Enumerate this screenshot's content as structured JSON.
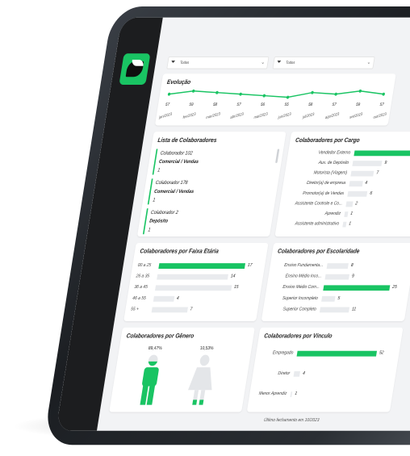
{
  "filters": [
    {
      "label": "Todos"
    },
    {
      "label": "Todos"
    }
  ],
  "evolucao": {
    "title": "Evolução",
    "points": [
      57,
      59,
      58,
      57,
      56,
      55,
      58,
      57,
      59,
      57
    ],
    "months": [
      "jan/2023",
      "fev/2023",
      "mar/2023",
      "abr/2023",
      "mai/2023",
      "jun/2023",
      "jul/2023",
      "ago/2023",
      "set/2023",
      "out/2023"
    ]
  },
  "lista": {
    "title": "Lista de Colaboradores",
    "items": [
      {
        "name": "Colaborador 102",
        "dept": "Comercial / Vendas",
        "count": "1"
      },
      {
        "name": "Colaborador 178",
        "dept": "Comercial / Vendas",
        "count": "1"
      },
      {
        "name": "Colaborador 2",
        "dept": "Depósito",
        "count": "1"
      }
    ]
  },
  "cargo": {
    "title": "Colaboradores por Cargo",
    "rows": [
      {
        "label": "Vendedor Externo",
        "value": 18
      },
      {
        "label": "Aux. de Depósito",
        "value": 9
      },
      {
        "label": "Motorista (Viagem)",
        "value": 7
      },
      {
        "label": "Diretor(a) de empresa",
        "value": 4
      },
      {
        "label": "Promotor(a) de Vendas",
        "value": 6
      },
      {
        "label": "Assistente Controle e Co...",
        "value": 2
      },
      {
        "label": "Aprendiz",
        "value": 1
      },
      {
        "label": "Assistente administrativo",
        "value": 1
      }
    ]
  },
  "faixa": {
    "title": "Colaboradores por Faixa Etária",
    "rows": [
      {
        "label": "00 a 25",
        "value": 17
      },
      {
        "label": "26 a 35",
        "value": 14
      },
      {
        "label": "36 a 45",
        "value": 15
      },
      {
        "label": "46 a 55",
        "value": 4
      },
      {
        "label": "55 +",
        "value": 7
      }
    ]
  },
  "escolaridade": {
    "title": "Colaboradores por Escolaridade",
    "rows": [
      {
        "label": "Ensino Fundamenta...",
        "value": 8
      },
      {
        "label": "Ensino Médio Inco...",
        "value": 9
      },
      {
        "label": "Ensino Médio Com...",
        "value": 25
      },
      {
        "label": "Superior Incompleto",
        "value": 5
      },
      {
        "label": "Superior Completo",
        "value": 11
      }
    ]
  },
  "genero": {
    "title": "Colaboradores por Gênero",
    "male_pct": "89,47%",
    "female_pct": "10,53%",
    "male_fill": 0.8947,
    "female_fill": 0.1053
  },
  "vinculo": {
    "title": "Colaboradores por Vínculo",
    "rows": [
      {
        "label": "Empregado",
        "value": 52
      },
      {
        "label": "Diretor",
        "value": 4
      },
      {
        "label": "Menor Aprendiz",
        "value": 1
      }
    ]
  },
  "footer": "Último fechamento em 10/2023",
  "colors": {
    "accent": "#19c463",
    "bar_bg": "#e9ebee",
    "sidebar": "#1c1d1f"
  }
}
